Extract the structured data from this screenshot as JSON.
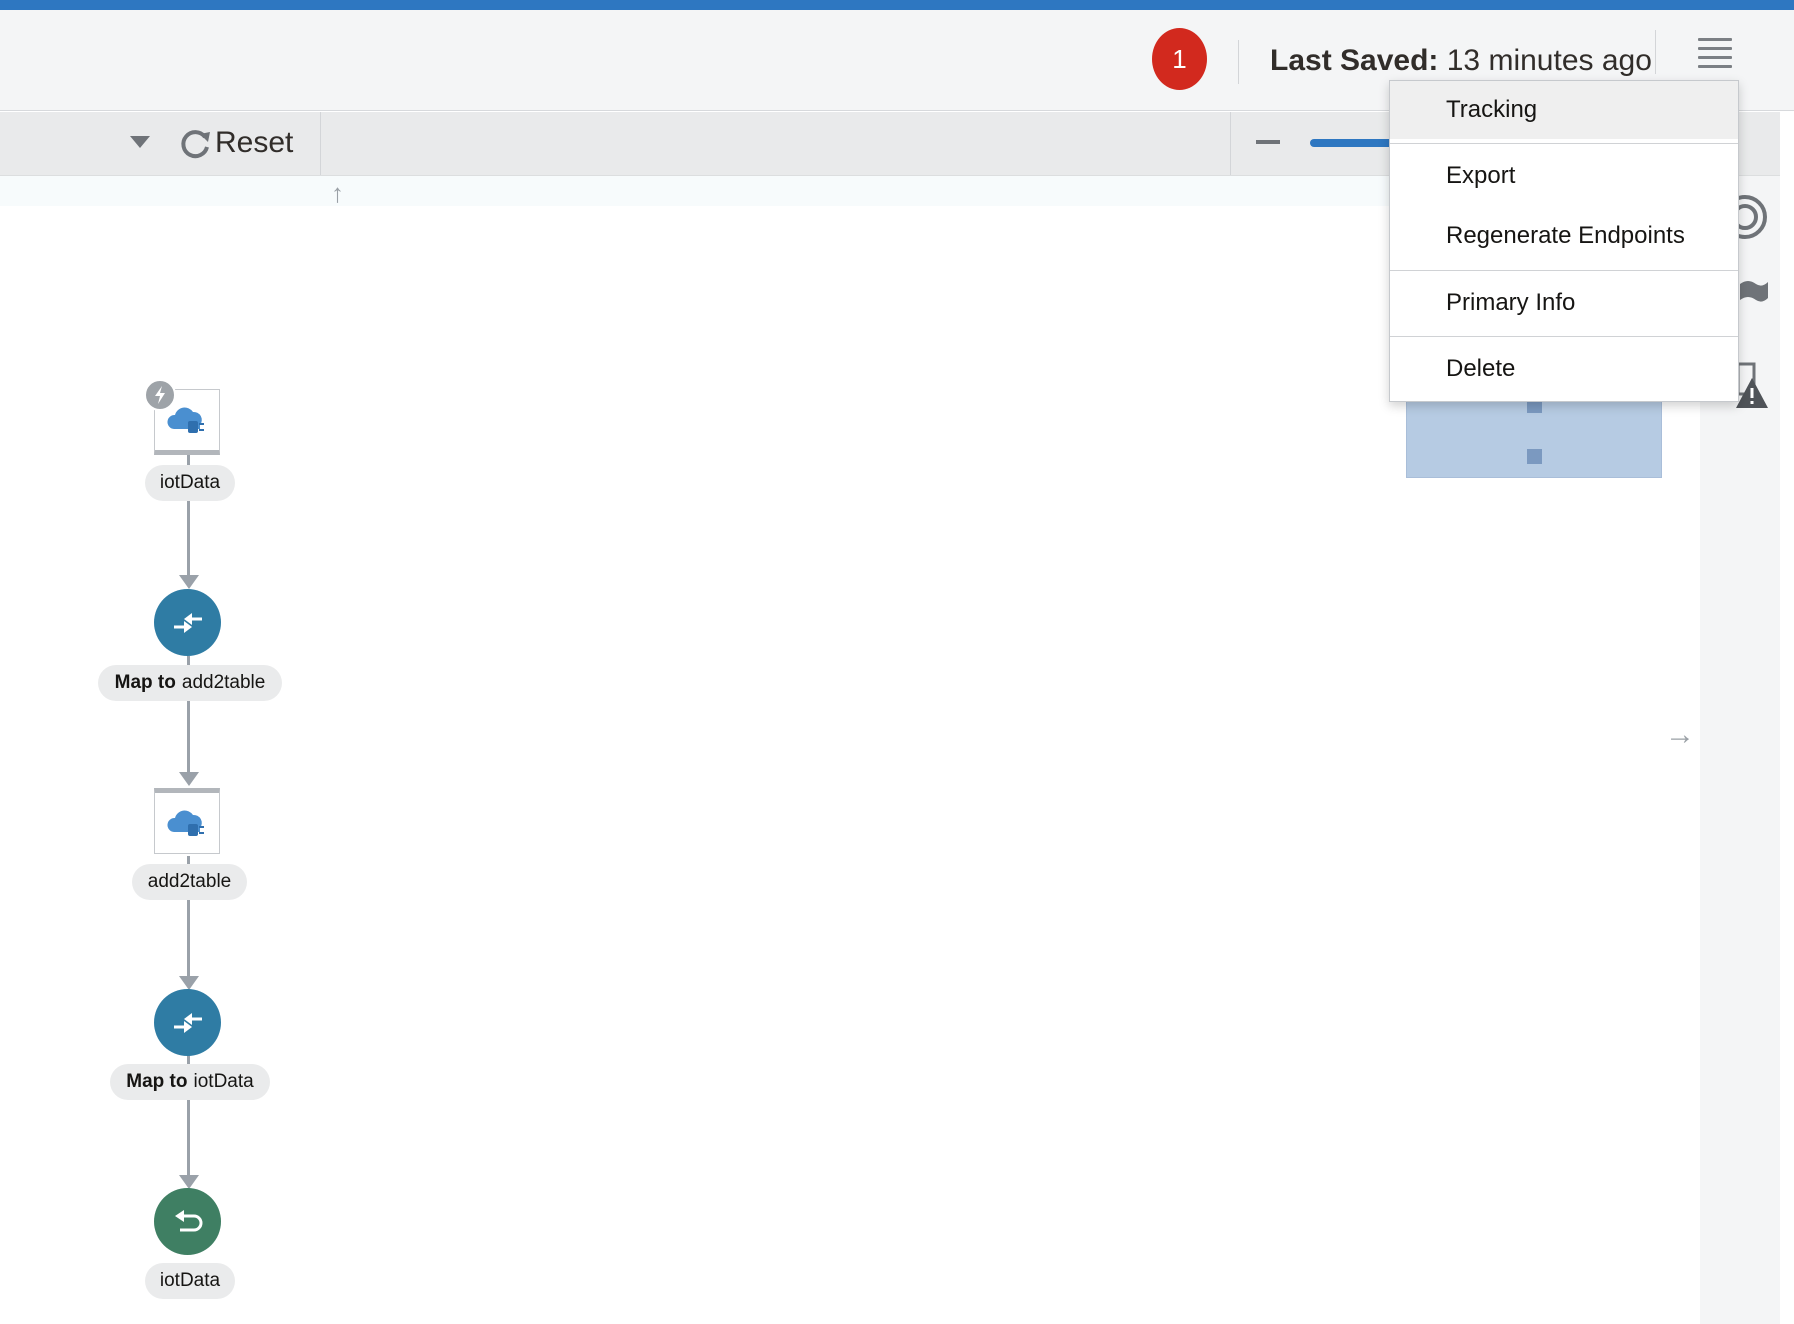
{
  "header": {
    "notification_count": "1",
    "last_saved_label": "Last Saved:",
    "last_saved_value": "13 minutes ago",
    "menu_icon": "hamburger-menu-icon"
  },
  "toolbar": {
    "reset_label": "Reset",
    "dropdown_icon": "caret-down-icon",
    "reset_icon": "refresh-icon",
    "zoom_out_icon": "minus-icon"
  },
  "canvas": {
    "up_arrow": "↑",
    "right_arrow": "→"
  },
  "flow": {
    "nodes": [
      {
        "type": "trigger",
        "label": "iotData",
        "icon": "cloud-adapter-icon"
      },
      {
        "type": "map",
        "label_prefix": "Map to",
        "label": "add2table",
        "icon": "map-icon"
      },
      {
        "type": "invoke",
        "label": "add2table",
        "icon": "cloud-adapter-icon"
      },
      {
        "type": "map",
        "label_prefix": "Map to",
        "label": "iotData",
        "icon": "map-icon"
      },
      {
        "type": "return",
        "label": "iotData",
        "icon": "return-icon"
      }
    ]
  },
  "menu": {
    "items": [
      "Tracking",
      "Export",
      "Regenerate Endpoints",
      "Primary Info",
      "Delete"
    ]
  },
  "colors": {
    "accent": "#2e77c1",
    "badge": "#d2291e",
    "map_node": "#2f7ca4",
    "return_node": "#3f7f63"
  }
}
